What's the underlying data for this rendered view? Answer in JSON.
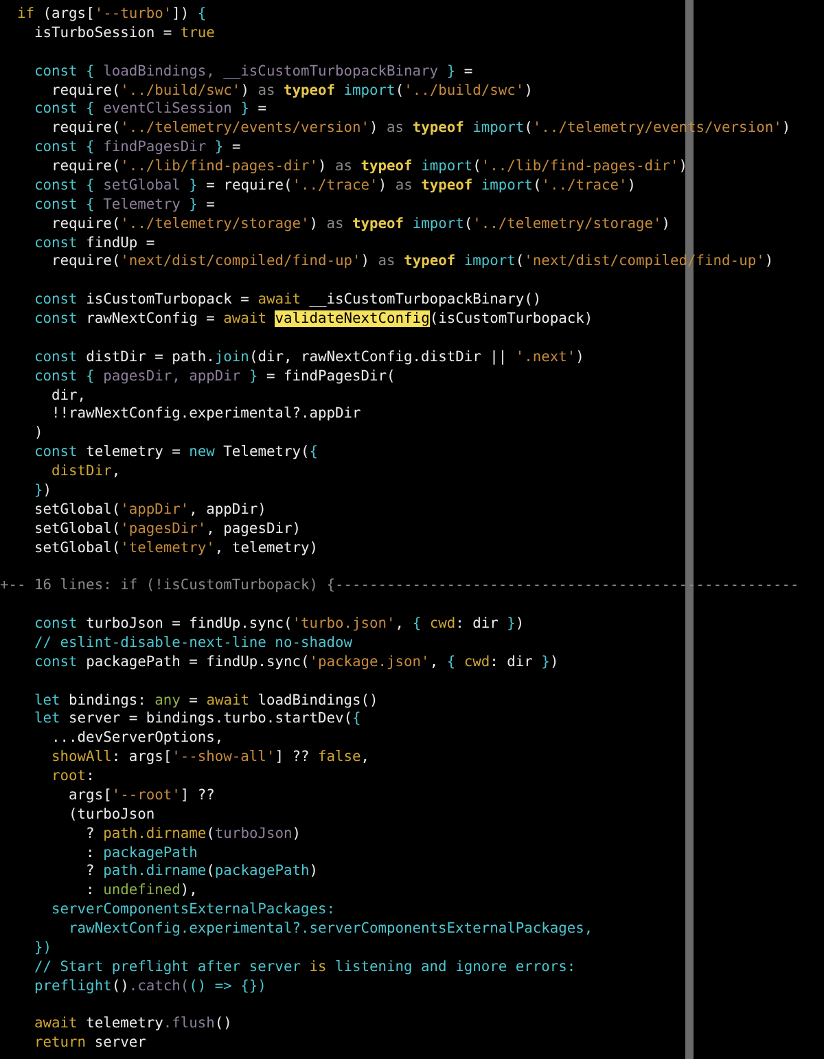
{
  "editor": {
    "lines": [
      {
        "kind": "code",
        "tokens": [
          {
            "t": "  if",
            "kind": "aw"
          },
          {
            "t": " (args[",
            "kind": "plain"
          },
          {
            "t": "'--turbo'",
            "kind": "s"
          },
          {
            "t": "]) ",
            "kind": "plain"
          },
          {
            "t": "{",
            "kind": "kw"
          }
        ]
      },
      {
        "kind": "code",
        "tokens": [
          {
            "t": "    isTurboSession = ",
            "kind": "plain"
          },
          {
            "t": "true",
            "kind": "aw"
          }
        ]
      },
      {
        "kind": "blank"
      },
      {
        "kind": "code",
        "tokens": [
          {
            "t": "    const {",
            "kind": "kw"
          },
          {
            "t": " loadBindings, __isCustomTurbopackBinary ",
            "kind": "v"
          },
          {
            "t": "}",
            "kind": "kw"
          },
          {
            "t": " =",
            "kind": "plain"
          }
        ]
      },
      {
        "kind": "code",
        "tokens": [
          {
            "t": "      require(",
            "kind": "plain"
          },
          {
            "t": "'../build/swc'",
            "kind": "s"
          },
          {
            "t": ") ",
            "kind": "plain"
          },
          {
            "t": "as ",
            "kind": "as"
          },
          {
            "t": "typeof ",
            "kind": "ty"
          },
          {
            "t": "import",
            "kind": "kw"
          },
          {
            "t": "(",
            "kind": "plain"
          },
          {
            "t": "'../build/swc'",
            "kind": "s"
          },
          {
            "t": ")",
            "kind": "plain"
          }
        ]
      },
      {
        "kind": "code",
        "tokens": [
          {
            "t": "    const {",
            "kind": "kw"
          },
          {
            "t": " eventCliSession ",
            "kind": "v"
          },
          {
            "t": "}",
            "kind": "kw"
          },
          {
            "t": " =",
            "kind": "plain"
          }
        ]
      },
      {
        "kind": "code",
        "tokens": [
          {
            "t": "      require(",
            "kind": "plain"
          },
          {
            "t": "'../telemetry/events/version'",
            "kind": "s"
          },
          {
            "t": ") ",
            "kind": "plain"
          },
          {
            "t": "as ",
            "kind": "as"
          },
          {
            "t": "typeof ",
            "kind": "ty"
          },
          {
            "t": "import",
            "kind": "kw"
          },
          {
            "t": "(",
            "kind": "plain"
          },
          {
            "t": "'../telemetry/events/version'",
            "kind": "s"
          },
          {
            "t": ")",
            "kind": "plain"
          }
        ]
      },
      {
        "kind": "code",
        "tokens": [
          {
            "t": "    const {",
            "kind": "kw"
          },
          {
            "t": " findPagesDir ",
            "kind": "v"
          },
          {
            "t": "}",
            "kind": "kw"
          },
          {
            "t": " =",
            "kind": "plain"
          }
        ]
      },
      {
        "kind": "code",
        "tokens": [
          {
            "t": "      require(",
            "kind": "plain"
          },
          {
            "t": "'../lib/find-pages-dir'",
            "kind": "s"
          },
          {
            "t": ") ",
            "kind": "plain"
          },
          {
            "t": "as ",
            "kind": "as"
          },
          {
            "t": "typeof ",
            "kind": "ty"
          },
          {
            "t": "import",
            "kind": "kw"
          },
          {
            "t": "(",
            "kind": "plain"
          },
          {
            "t": "'../lib/find-pages-dir'",
            "kind": "s"
          },
          {
            "t": ")",
            "kind": "plain"
          }
        ]
      },
      {
        "kind": "code",
        "tokens": [
          {
            "t": "    const {",
            "kind": "kw"
          },
          {
            "t": " setGlobal ",
            "kind": "v"
          },
          {
            "t": "}",
            "kind": "kw"
          },
          {
            "t": " = require(",
            "kind": "plain"
          },
          {
            "t": "'../trace'",
            "kind": "s"
          },
          {
            "t": ") ",
            "kind": "plain"
          },
          {
            "t": "as ",
            "kind": "as"
          },
          {
            "t": "typeof ",
            "kind": "ty"
          },
          {
            "t": "import",
            "kind": "kw"
          },
          {
            "t": "(",
            "kind": "plain"
          },
          {
            "t": "'../trace'",
            "kind": "s"
          },
          {
            "t": ")",
            "kind": "plain"
          }
        ]
      },
      {
        "kind": "code",
        "tokens": [
          {
            "t": "    const {",
            "kind": "kw"
          },
          {
            "t": " Telemetry ",
            "kind": "v"
          },
          {
            "t": "}",
            "kind": "kw"
          },
          {
            "t": " =",
            "kind": "plain"
          }
        ]
      },
      {
        "kind": "code",
        "tokens": [
          {
            "t": "      require(",
            "kind": "plain"
          },
          {
            "t": "'../telemetry/storage'",
            "kind": "s"
          },
          {
            "t": ") ",
            "kind": "plain"
          },
          {
            "t": "as ",
            "kind": "as"
          },
          {
            "t": "typeof ",
            "kind": "ty"
          },
          {
            "t": "import",
            "kind": "kw"
          },
          {
            "t": "(",
            "kind": "plain"
          },
          {
            "t": "'../telemetry/storage'",
            "kind": "s"
          },
          {
            "t": ")",
            "kind": "plain"
          }
        ]
      },
      {
        "kind": "code",
        "tokens": [
          {
            "t": "    const",
            "kind": "kw"
          },
          {
            "t": " findUp =",
            "kind": "plain"
          }
        ]
      },
      {
        "kind": "code",
        "tokens": [
          {
            "t": "      require(",
            "kind": "plain"
          },
          {
            "t": "'next/dist/compiled/find-up'",
            "kind": "s"
          },
          {
            "t": ") ",
            "kind": "plain"
          },
          {
            "t": "as ",
            "kind": "as"
          },
          {
            "t": "typeof ",
            "kind": "ty"
          },
          {
            "t": "import",
            "kind": "kw"
          },
          {
            "t": "(",
            "kind": "plain"
          },
          {
            "t": "'next/dist/compiled/find-up'",
            "kind": "s"
          },
          {
            "t": ")",
            "kind": "plain"
          }
        ]
      },
      {
        "kind": "blank"
      },
      {
        "kind": "code",
        "tokens": [
          {
            "t": "    const",
            "kind": "kw"
          },
          {
            "t": " isCustomTurbopack = ",
            "kind": "plain"
          },
          {
            "t": "await",
            "kind": "aw"
          },
          {
            "t": " __isCustomTurbopackBinary()",
            "kind": "plain"
          }
        ]
      },
      {
        "kind": "code",
        "tokens": [
          {
            "t": "    const",
            "kind": "kw"
          },
          {
            "t": " rawNextConfig = ",
            "kind": "plain"
          },
          {
            "t": "await ",
            "kind": "aw"
          },
          {
            "t": "validateNextConfig",
            "kind": "hl"
          },
          {
            "t": "(isCustomTurbopack)",
            "kind": "plain"
          }
        ]
      },
      {
        "kind": "blank"
      },
      {
        "kind": "code",
        "tokens": [
          {
            "t": "    const",
            "kind": "kw"
          },
          {
            "t": " distDir = path.",
            "kind": "plain"
          },
          {
            "t": "join",
            "kind": "kw"
          },
          {
            "t": "(dir, rawNextConfig.distDir || ",
            "kind": "plain"
          },
          {
            "t": "'.next'",
            "kind": "s"
          },
          {
            "t": ")",
            "kind": "plain"
          }
        ]
      },
      {
        "kind": "code",
        "tokens": [
          {
            "t": "    const {",
            "kind": "kw"
          },
          {
            "t": " pagesDir, appDir ",
            "kind": "v"
          },
          {
            "t": "}",
            "kind": "kw"
          },
          {
            "t": " = findPagesDir(",
            "kind": "plain"
          }
        ]
      },
      {
        "kind": "code",
        "tokens": [
          {
            "t": "      dir,",
            "kind": "plain"
          }
        ]
      },
      {
        "kind": "code",
        "tokens": [
          {
            "t": "      !!rawNextConfig.experimental?.appDir",
            "kind": "plain"
          }
        ]
      },
      {
        "kind": "code",
        "tokens": [
          {
            "t": "    )",
            "kind": "plain"
          }
        ]
      },
      {
        "kind": "code",
        "tokens": [
          {
            "t": "    const",
            "kind": "kw"
          },
          {
            "t": " telemetry = ",
            "kind": "plain"
          },
          {
            "t": "new",
            "kind": "kw"
          },
          {
            "t": " Telemetry(",
            "kind": "plain"
          },
          {
            "t": "{",
            "kind": "kw"
          }
        ]
      },
      {
        "kind": "code",
        "tokens": [
          {
            "t": "      distDir",
            "kind": "aw"
          },
          {
            "t": ",",
            "kind": "plain"
          }
        ]
      },
      {
        "kind": "code",
        "tokens": [
          {
            "t": "    }",
            "kind": "kw"
          },
          {
            "t": ")",
            "kind": "plain"
          }
        ]
      },
      {
        "kind": "code",
        "tokens": [
          {
            "t": "    setGlobal(",
            "kind": "plain"
          },
          {
            "t": "'appDir'",
            "kind": "s"
          },
          {
            "t": ", appDir)",
            "kind": "plain"
          }
        ]
      },
      {
        "kind": "code",
        "tokens": [
          {
            "t": "    setGlobal(",
            "kind": "plain"
          },
          {
            "t": "'pagesDir'",
            "kind": "s"
          },
          {
            "t": ", pagesDir)",
            "kind": "plain"
          }
        ]
      },
      {
        "kind": "code",
        "tokens": [
          {
            "t": "    setGlobal(",
            "kind": "plain"
          },
          {
            "t": "'telemetry'",
            "kind": "s"
          },
          {
            "t": ", telemetry)",
            "kind": "plain"
          }
        ]
      },
      {
        "kind": "blank"
      },
      {
        "kind": "fold",
        "tokens": [
          {
            "t": "+-- 16 lines: if (!isCustomTurbopack) {------------------------------------------------------",
            "kind": "plain"
          }
        ]
      },
      {
        "kind": "blank"
      },
      {
        "kind": "code",
        "tokens": [
          {
            "t": "    const",
            "kind": "kw"
          },
          {
            "t": " turboJson = findUp.sync(",
            "kind": "plain"
          },
          {
            "t": "'turbo.json'",
            "kind": "s"
          },
          {
            "t": ", ",
            "kind": "plain"
          },
          {
            "t": "{ ",
            "kind": "kw"
          },
          {
            "t": "cwd",
            "kind": "aw"
          },
          {
            "t": ": dir ",
            "kind": "plain"
          },
          {
            "t": "}",
            "kind": "kw"
          },
          {
            "t": ")",
            "kind": "plain"
          }
        ]
      },
      {
        "kind": "code",
        "tokens": [
          {
            "t": "    // eslint-disable-next-line no-shadow",
            "kind": "kw"
          }
        ]
      },
      {
        "kind": "code",
        "tokens": [
          {
            "t": "    const",
            "kind": "kw"
          },
          {
            "t": " packagePath = findUp.sync(",
            "kind": "plain"
          },
          {
            "t": "'package.json'",
            "kind": "s"
          },
          {
            "t": ", ",
            "kind": "plain"
          },
          {
            "t": "{ ",
            "kind": "kw"
          },
          {
            "t": "cwd",
            "kind": "aw"
          },
          {
            "t": ": dir ",
            "kind": "plain"
          },
          {
            "t": "}",
            "kind": "kw"
          },
          {
            "t": ")",
            "kind": "plain"
          }
        ]
      },
      {
        "kind": "blank"
      },
      {
        "kind": "code",
        "tokens": [
          {
            "t": "    let",
            "kind": "kw"
          },
          {
            "t": " bindings: ",
            "kind": "plain"
          },
          {
            "t": "any",
            "kind": "g"
          },
          {
            "t": " = ",
            "kind": "plain"
          },
          {
            "t": "await",
            "kind": "aw"
          },
          {
            "t": " loadBindings()",
            "kind": "plain"
          }
        ]
      },
      {
        "kind": "code",
        "tokens": [
          {
            "t": "    let",
            "kind": "kw"
          },
          {
            "t": " server = bindings.turbo.startDev(",
            "kind": "plain"
          },
          {
            "t": "{",
            "kind": "kw"
          }
        ]
      },
      {
        "kind": "code",
        "tokens": [
          {
            "t": "      ...devServerOptions,",
            "kind": "plain"
          }
        ]
      },
      {
        "kind": "code",
        "tokens": [
          {
            "t": "      showAll",
            "kind": "aw"
          },
          {
            "t": ": args[",
            "kind": "plain"
          },
          {
            "t": "'--show-all'",
            "kind": "s"
          },
          {
            "t": "] ?? ",
            "kind": "plain"
          },
          {
            "t": "false",
            "kind": "aw"
          },
          {
            "t": ",",
            "kind": "plain"
          }
        ]
      },
      {
        "kind": "code",
        "tokens": [
          {
            "t": "      root",
            "kind": "aw"
          },
          {
            "t": ":",
            "kind": "plain"
          }
        ]
      },
      {
        "kind": "code",
        "tokens": [
          {
            "t": "        args[",
            "kind": "plain"
          },
          {
            "t": "'--root'",
            "kind": "s"
          },
          {
            "t": "] ??",
            "kind": "plain"
          }
        ]
      },
      {
        "kind": "code",
        "tokens": [
          {
            "t": "        (turboJson",
            "kind": "plain"
          }
        ]
      },
      {
        "kind": "code",
        "tokens": [
          {
            "t": "          ? ",
            "kind": "plain"
          },
          {
            "t": "path.dirname",
            "kind": "aw"
          },
          {
            "t": "(",
            "kind": "plain"
          },
          {
            "t": "turboJson",
            "kind": "v"
          },
          {
            "t": ")",
            "kind": "plain"
          }
        ]
      },
      {
        "kind": "code",
        "tokens": [
          {
            "t": "          : ",
            "kind": "plain"
          },
          {
            "t": "packagePath",
            "kind": "kw"
          }
        ]
      },
      {
        "kind": "code",
        "tokens": [
          {
            "t": "          ? ",
            "kind": "plain"
          },
          {
            "t": "path.dirname",
            "kind": "kw"
          },
          {
            "t": "(",
            "kind": "plain"
          },
          {
            "t": "packagePath",
            "kind": "kw"
          },
          {
            "t": ")",
            "kind": "plain"
          }
        ]
      },
      {
        "kind": "code",
        "tokens": [
          {
            "t": "          : ",
            "kind": "plain"
          },
          {
            "t": "undefined",
            "kind": "g"
          },
          {
            "t": "),",
            "kind": "plain"
          }
        ]
      },
      {
        "kind": "code",
        "tokens": [
          {
            "t": "      serverComponentsExternalPackages:",
            "kind": "kw"
          }
        ]
      },
      {
        "kind": "code",
        "tokens": [
          {
            "t": "        rawNextConfig.experimental?.serverComponentsExternalPackages,",
            "kind": "kw"
          }
        ]
      },
      {
        "kind": "code",
        "tokens": [
          {
            "t": "    })",
            "kind": "kw"
          }
        ]
      },
      {
        "kind": "code",
        "tokens": [
          {
            "t": "    // Start preflight after server ",
            "kind": "kw"
          },
          {
            "t": "is",
            "kind": "aw"
          },
          {
            "t": " listening and ignore errors:",
            "kind": "kw"
          }
        ]
      },
      {
        "kind": "code",
        "tokens": [
          {
            "t": "    preflight",
            "kind": "kw"
          },
          {
            "t": "()",
            "kind": "plain"
          },
          {
            "t": ".catch(",
            "kind": "v"
          },
          {
            "t": "() => {})",
            "kind": "kw"
          }
        ]
      },
      {
        "kind": "blank"
      },
      {
        "kind": "code",
        "tokens": [
          {
            "t": "    await",
            "kind": "aw"
          },
          {
            "t": " telemetry",
            "kind": "plain"
          },
          {
            "t": ".flush",
            "kind": "v"
          },
          {
            "t": "()",
            "kind": "plain"
          }
        ]
      },
      {
        "kind": "code",
        "tokens": [
          {
            "t": "    return",
            "kind": "aw"
          },
          {
            "t": " server",
            "kind": "plain"
          }
        ]
      }
    ]
  }
}
